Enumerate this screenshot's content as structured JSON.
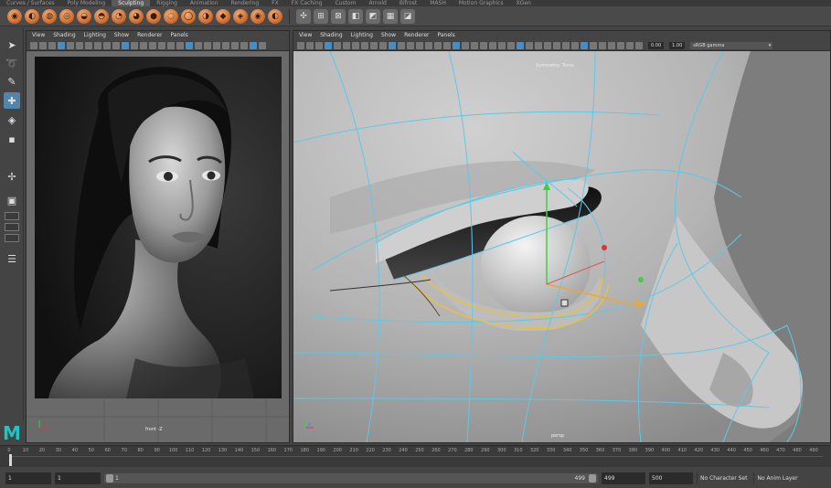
{
  "shelf": {
    "tabs": [
      "Curves / Surfaces",
      "Poly Modeling",
      "Sculpting",
      "Rigging",
      "Animation",
      "Rendering",
      "FX",
      "FX Caching",
      "Custom",
      "Arnold",
      "Bifrost",
      "MASH",
      "Motion Graphics",
      "XGen"
    ],
    "active_tab": "Sculpting",
    "tool_count": 16,
    "extra_count": 7
  },
  "left_panel": {
    "menu": [
      "View",
      "Shading",
      "Lighting",
      "Show",
      "Renderer",
      "Panels"
    ],
    "camera_label": "front -Z"
  },
  "right_panel": {
    "menu": [
      "View",
      "Shading",
      "Lighting",
      "Show",
      "Renderer",
      "Panels"
    ],
    "camera_label": "persp",
    "symmetry_label": "Symmetry: Torso",
    "exposure": "0.00",
    "gamma": "1.00",
    "color_space": "sRGB gamma"
  },
  "timeline": {
    "ticks": [
      "0",
      "10",
      "20",
      "30",
      "40",
      "50",
      "60",
      "70",
      "80",
      "90",
      "100",
      "110",
      "120",
      "130",
      "140",
      "150",
      "160",
      "170",
      "180",
      "190",
      "200",
      "210",
      "220",
      "230",
      "240",
      "250",
      "260",
      "270",
      "280",
      "290",
      "300",
      "310",
      "320",
      "330",
      "340",
      "350",
      "360",
      "370",
      "380",
      "390",
      "400",
      "410",
      "420",
      "430",
      "440",
      "450",
      "460",
      "470",
      "480",
      "490"
    ],
    "current_frame": "1"
  },
  "range": {
    "start": "1",
    "playback_start": "1",
    "slider_start": "1",
    "slider_end": "499",
    "playback_end": "499",
    "end": "500",
    "character_set": "No Character Set",
    "anim_layer": "No Anim Layer"
  },
  "colors": {
    "accent": "#5285a6",
    "maya_logo": "#21c4c4",
    "wire": "#5ec8e6",
    "selection": "#e8c23a"
  }
}
